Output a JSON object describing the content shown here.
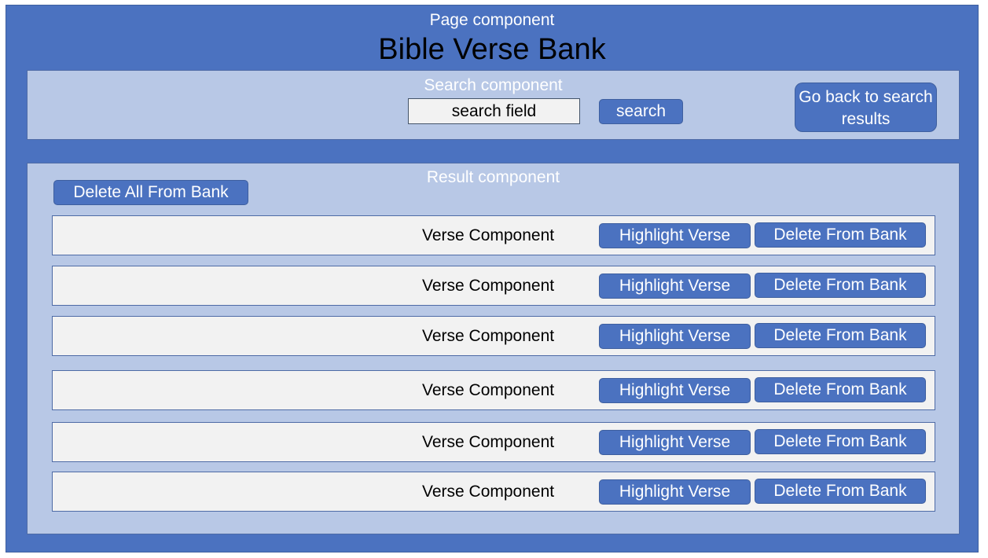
{
  "page": {
    "label": "Page component",
    "title": "Bible Verse Bank"
  },
  "search": {
    "label": "Search component",
    "field_text": "search field",
    "search_button": "search",
    "back_button": "Go back to search results"
  },
  "results": {
    "label": "Result component",
    "delete_all_button": "Delete All From Bank",
    "verses": [
      {
        "label": "Verse Component",
        "highlight": "Highlight Verse",
        "delete": "Delete From Bank"
      },
      {
        "label": "Verse Component",
        "highlight": "Highlight Verse",
        "delete": "Delete From Bank"
      },
      {
        "label": "Verse Component",
        "highlight": "Highlight Verse",
        "delete": "Delete From Bank"
      },
      {
        "label": "Verse Component",
        "highlight": "Highlight Verse",
        "delete": "Delete From Bank"
      },
      {
        "label": "Verse Component",
        "highlight": "Highlight Verse",
        "delete": "Delete From Bank"
      },
      {
        "label": "Verse Component",
        "highlight": "Highlight Verse",
        "delete": "Delete From Bank"
      }
    ]
  }
}
